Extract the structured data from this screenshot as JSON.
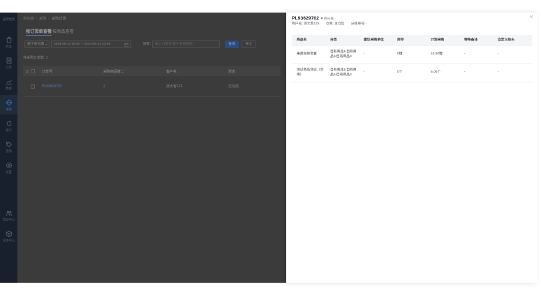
{
  "colors": {
    "accent": "#3b7cf0",
    "sidebar_bg": "#1b2330",
    "active_menu": "#4679b8"
  },
  "sidebar": {
    "title": "品牌档案",
    "items": [
      {
        "label": "商品",
        "icon": "shopping-bag-icon"
      },
      {
        "label": "订单",
        "icon": "document-icon"
      },
      {
        "label": "数据",
        "icon": "chart-icon"
      },
      {
        "label": "采购",
        "icon": "purchase-icon",
        "active": true
      },
      {
        "label": "客户",
        "icon": "refresh-icon"
      },
      {
        "label": "营销",
        "icon": "tag-icon"
      },
      {
        "label": "设置",
        "icon": "gear-icon"
      }
    ],
    "bottom_items": [
      {
        "label": "帮助中心",
        "icon": "people-icon"
      },
      {
        "label": "应用中心",
        "icon": "box-icon"
      }
    ]
  },
  "breadcrumb": {
    "items": [
      "供应链",
      "采购",
      "采购详情"
    ],
    "separator": "/"
  },
  "tabs": [
    {
      "label": "按订货单查看",
      "active": true
    },
    {
      "label": "按商品查看",
      "active": false
    }
  ],
  "filters": {
    "date_type": "按下单日期",
    "date_range": "2024-05-13 00:00 ~ 2024-05-13 23:59",
    "search_label": "搜索:",
    "search_placeholder": "输入订单号/客户名称搜索",
    "query_button": "查询",
    "export_button": "导出"
  },
  "summary": {
    "label": "共采购订单数:",
    "count": "1"
  },
  "orders_table": {
    "columns": [
      "订单号",
      "采购商品数",
      "客户名",
      "状态"
    ],
    "rows": [
      {
        "order_no": "PL93629702",
        "item_count": "2",
        "customer": "测大客123",
        "status": "已完成"
      }
    ]
  },
  "drawer": {
    "order_no": "PL93629702",
    "status": "待分拣",
    "meta": [
      {
        "text": "商户名: 测大客123"
      },
      {
        "text": "仓库: 主仓区"
      },
      {
        "text": "分拣单号: -"
      }
    ],
    "columns": [
      "商品名",
      "分类",
      "建议采购单位",
      "库存",
      "计划采购",
      "特殊备注",
      "自定义抬头"
    ],
    "rows": [
      {
        "name": "果蔬生鲜套餐",
        "category": "自有商品1/自有商品2/自有商品3",
        "unit": "-",
        "stock": "0罐",
        "plan": "10.00罐",
        "remark": "-",
        "custom": "-"
      },
      {
        "name": "测试商品测试（勿用）",
        "category": "自有商品1/自有商品2/自有商品3",
        "unit": "-",
        "stock": "0个",
        "plan": "5.00个",
        "remark": "-",
        "custom": "-"
      }
    ]
  }
}
